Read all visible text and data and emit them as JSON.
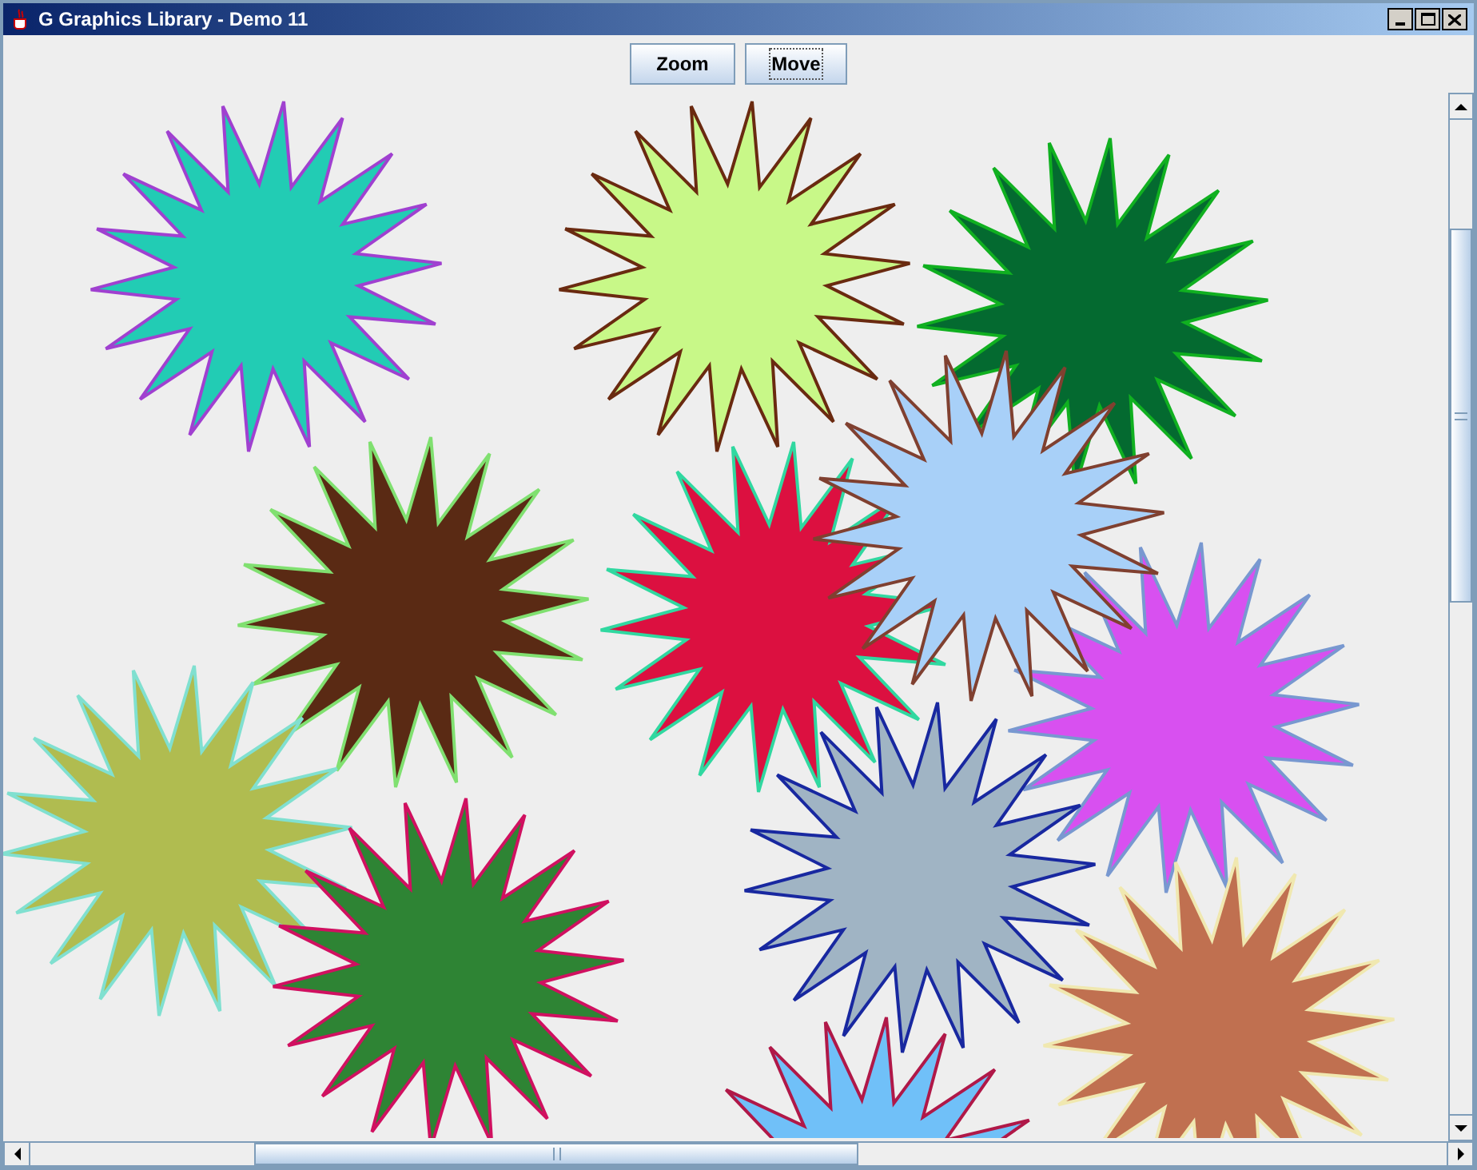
{
  "window": {
    "title": "G Graphics Library - Demo 11"
  },
  "buttons": [
    {
      "label": "Zoom",
      "focused": false
    },
    {
      "label": "Move",
      "focused": true
    }
  ]
}
